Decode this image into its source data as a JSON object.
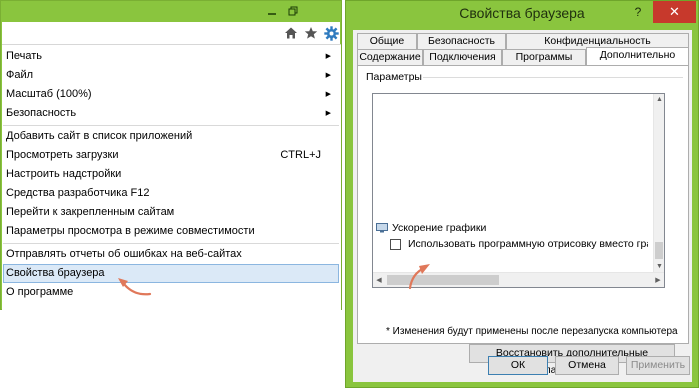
{
  "ie_window": {
    "icons": [
      "minimize-icon",
      "restore-icon",
      "home-icon",
      "favorites-star-icon",
      "tools-gear-icon"
    ]
  },
  "tools_menu": {
    "items": [
      {
        "label": "Печать",
        "submenu": true
      },
      {
        "label": "Файл",
        "submenu": true
      },
      {
        "label": "Масштаб (100%)",
        "submenu": true
      },
      {
        "label": "Безопасность",
        "submenu": true
      },
      {
        "label": "Добавить сайт в список приложений"
      },
      {
        "label": "Просмотреть загрузки",
        "shortcut": "CTRL+J"
      },
      {
        "label": "Настроить надстройки"
      },
      {
        "label": "Средства разработчика F12"
      },
      {
        "label": "Перейти к закрепленным сайтам"
      },
      {
        "label": "Параметры просмотра в режиме совместимости"
      },
      {
        "label": "Отправлять отчеты об ошибках на веб-сайтах"
      },
      {
        "label": "Свойства браузера",
        "selected": true
      },
      {
        "label": "О программе"
      }
    ]
  },
  "dialog": {
    "title": "Свойства браузера",
    "help_label": "?",
    "close_label": "✕",
    "tabs_row1": [
      "Общие",
      "Безопасность",
      "Конфиденциальность"
    ],
    "tabs_row2": [
      "Содержание",
      "Подключения",
      "Программы",
      "Дополнительно"
    ],
    "active_tab": "Дополнительно",
    "group_label": "Параметры",
    "tree_category": "Ускорение графики",
    "checkbox_label": "Использовать программную отрисовку вместо графического процессора",
    "checkbox_checked": false,
    "note": "* Изменения будут применены после перезапуска компьютера",
    "restore_button": "Восстановить дополнительные параметры",
    "ok_button": "ОК",
    "cancel_button": "Отмена",
    "apply_button": "Применить"
  },
  "colors": {
    "window_frame": "#8ac53e",
    "close_button": "#c7392c",
    "menu_highlight": "#dbe9f7",
    "annotation_arrow": "#e0785a"
  }
}
